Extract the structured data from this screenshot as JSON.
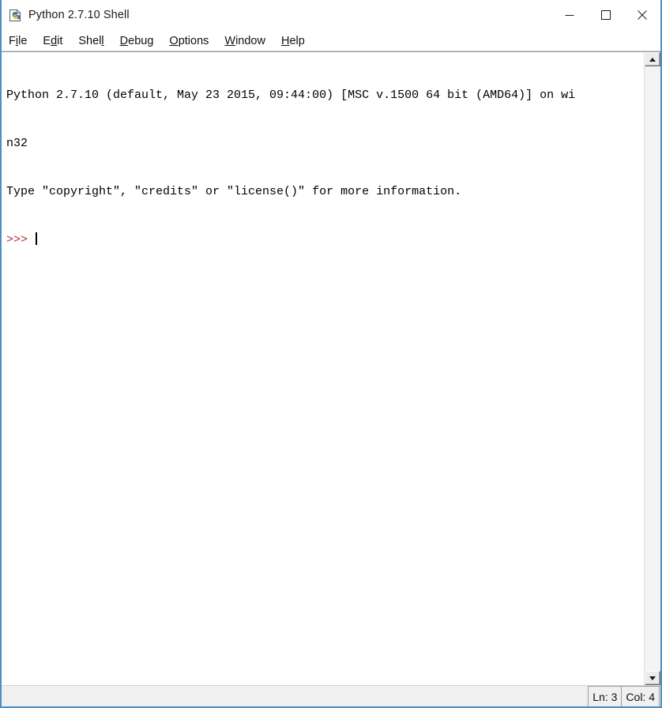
{
  "window": {
    "title": "Python 2.7.10 Shell",
    "icon": "python-idle-icon",
    "border_color": "#4b8fc4",
    "titlebar_background": "#ffffff"
  },
  "window_controls": [
    {
      "name": "minimize-button",
      "glyph": "minimize-icon",
      "label": "Minimize"
    },
    {
      "name": "maximize-button",
      "glyph": "maximize-icon",
      "label": "Maximize"
    },
    {
      "name": "close-button",
      "glyph": "close-icon",
      "label": "Close"
    }
  ],
  "menubar": {
    "items": [
      {
        "label": "File",
        "before": "F",
        "mnemonic": "i",
        "after": "le"
      },
      {
        "label": "Edit",
        "before": "E",
        "mnemonic": "d",
        "after": "it"
      },
      {
        "label": "Shell",
        "before": "Shel",
        "mnemonic": "l",
        "after": ""
      },
      {
        "label": "Debug",
        "before": "",
        "mnemonic": "D",
        "after": "ebug"
      },
      {
        "label": "Options",
        "before": "",
        "mnemonic": "O",
        "after": "ptions"
      },
      {
        "label": "Window",
        "before": "",
        "mnemonic": "W",
        "after": "indow"
      },
      {
        "label": "Help",
        "before": "",
        "mnemonic": "H",
        "after": "elp"
      }
    ]
  },
  "console": {
    "line1": "Python 2.7.10 (default, May 23 2015, 09:44:00) [MSC v.1500 64 bit (AMD64)] on wi",
    "line2": "n32",
    "line3": "Type \"copyright\", \"credits\" or \"license()\" for more information.",
    "prompt": ">>>",
    "prompt_color": "#b0303a",
    "input_value": "",
    "text_color": "#000000",
    "background": "#ffffff"
  },
  "scrollbar": {
    "up_arrow": "scroll-up-icon",
    "down_arrow": "scroll-down-icon"
  },
  "statusbar": {
    "line": "Ln: 3",
    "col": "Col: 4"
  }
}
